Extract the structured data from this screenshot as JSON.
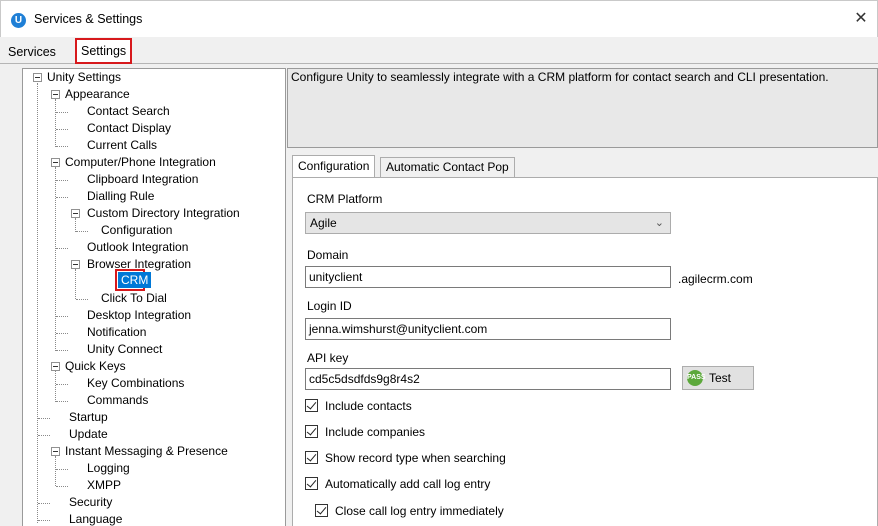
{
  "window": {
    "title": "Services & Settings",
    "app_icon_letter": "U",
    "close_glyph": "✕"
  },
  "top_tabs": {
    "services": "Services",
    "settings": "Settings"
  },
  "tree": {
    "unity_settings": "Unity Settings",
    "appearance": "Appearance",
    "contact_search": "Contact Search",
    "contact_display": "Contact Display",
    "current_calls": "Current Calls",
    "cti": "Computer/Phone Integration",
    "clipboard": "Clipboard Integration",
    "dialling_rule": "Dialling Rule",
    "custom_dir": "Custom Directory Integration",
    "configuration": "Configuration",
    "outlook": "Outlook Integration",
    "browser": "Browser Integration",
    "crm": "CRM",
    "click_to_dial": "Click To Dial",
    "desktop": "Desktop Integration",
    "notification": "Notification",
    "unity_connect": "Unity Connect",
    "quick_keys": "Quick Keys",
    "key_combinations": "Key Combinations",
    "commands": "Commands",
    "startup": "Startup",
    "update": "Update",
    "im_presence": "Instant Messaging & Presence",
    "logging": "Logging",
    "xmpp": "XMPP",
    "security": "Security",
    "language": "Language"
  },
  "description": "Configure Unity to seamlessly integrate with a CRM platform for contact search and CLI presentation.",
  "sub_tabs": {
    "configuration": "Configuration",
    "auto_pop": "Automatic Contact Pop"
  },
  "form": {
    "crm_platform_label": "CRM Platform",
    "crm_platform_value": "Agile",
    "domain_label": "Domain",
    "domain_value": "unityclient",
    "domain_suffix": ".agilecrm.com",
    "login_label": "Login ID",
    "login_value": "jenna.wimshurst@unityclient.com",
    "api_label": "API key",
    "api_value": "cd5c5dsdfds9g8r4s2",
    "test_button": "Test",
    "test_icon_text": "PASS",
    "include_contacts": "Include contacts",
    "include_companies": "Include companies",
    "show_record_type": "Show record type when searching",
    "auto_add_log": "Automatically add call log entry",
    "close_log": "Close call log entry immediately"
  }
}
